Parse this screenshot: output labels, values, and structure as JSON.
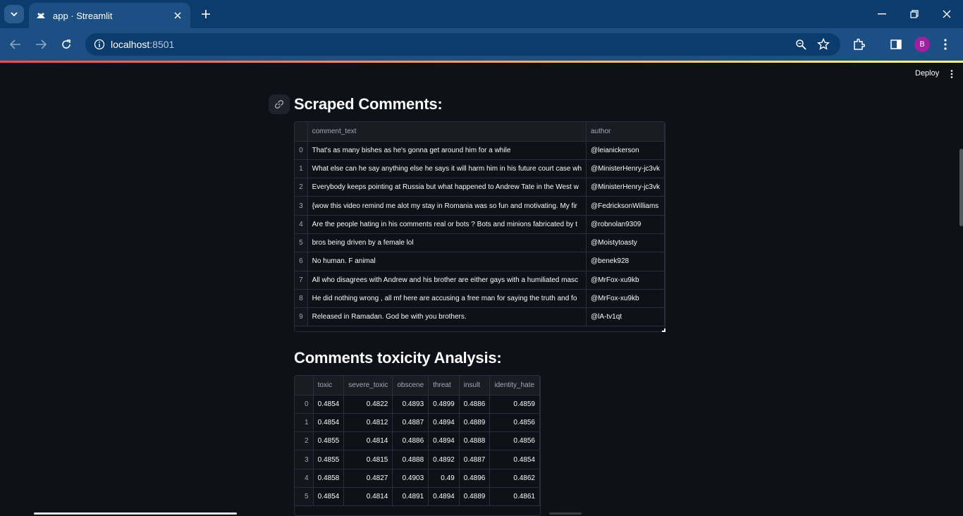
{
  "browser": {
    "tab_title": "app · Streamlit",
    "url_host": "localhost",
    "url_port": ":8501",
    "profile_initial": "B"
  },
  "header": {
    "deploy_label": "Deploy"
  },
  "section1": {
    "title": "Scraped Comments:",
    "columns": [
      "",
      "comment_text",
      "author"
    ],
    "rows": [
      {
        "idx": "0",
        "comment_text": "That's as many bishes as he's gonna get around him for a while",
        "author": "@leianickerson"
      },
      {
        "idx": "1",
        "comment_text": "What else can he say anything else he says it will harm him in his future court case wh",
        "author": "@MinisterHenry-jc3vk"
      },
      {
        "idx": "2",
        "comment_text": "Everybody keeps pointing at Russia but what happened to Andrew Tate in the West w",
        "author": "@MinisterHenry-jc3vk"
      },
      {
        "idx": "3",
        "comment_text": "{wow this video remind me alot my stay in Romania was so fun and motivating. My fir",
        "author": "@FedricksonWilliams"
      },
      {
        "idx": "4",
        "comment_text": "Are the people hating in his comments real or bots ? Bots and minions fabricated by t",
        "author": "@robnolan9309"
      },
      {
        "idx": "5",
        "comment_text": "bros being driven by a female lol",
        "author": "@Moistytoasty"
      },
      {
        "idx": "6",
        "comment_text": "No human. F animal",
        "author": "@benek928"
      },
      {
        "idx": "7",
        "comment_text": "All who disagrees with Andrew and his brother are either gays with a humiliated masc",
        "author": "@MrFox-xu9kb"
      },
      {
        "idx": "8",
        "comment_text": "He did nothing wrong , all mf here are accusing a free man for saying the truth and fo",
        "author": "@MrFox-xu9kb"
      },
      {
        "idx": "9",
        "comment_text": "Released in Ramadan. God be with you brothers.",
        "author": "@lA-tv1qt"
      }
    ]
  },
  "section2": {
    "title": "Comments toxicity Analysis:",
    "columns": [
      "",
      "toxic",
      "severe_toxic",
      "obscene",
      "threat",
      "insult",
      "identity_hate"
    ],
    "rows": [
      {
        "idx": "0",
        "toxic": "0.4854",
        "severe_toxic": "0.4822",
        "obscene": "0.4893",
        "threat": "0.4899",
        "insult": "0.4886",
        "identity_hate": "0.4859"
      },
      {
        "idx": "1",
        "toxic": "0.4854",
        "severe_toxic": "0.4812",
        "obscene": "0.4887",
        "threat": "0.4894",
        "insult": "0.4889",
        "identity_hate": "0.4856"
      },
      {
        "idx": "2",
        "toxic": "0.4855",
        "severe_toxic": "0.4814",
        "obscene": "0.4886",
        "threat": "0.4894",
        "insult": "0.4888",
        "identity_hate": "0.4856"
      },
      {
        "idx": "3",
        "toxic": "0.4855",
        "severe_toxic": "0.4815",
        "obscene": "0.4888",
        "threat": "0.4892",
        "insult": "0.4887",
        "identity_hate": "0.4854"
      },
      {
        "idx": "4",
        "toxic": "0.4858",
        "severe_toxic": "0.4827",
        "obscene": "0.4903",
        "threat": "0.49",
        "insult": "0.4896",
        "identity_hate": "0.4862"
      },
      {
        "idx": "5",
        "toxic": "0.4854",
        "severe_toxic": "0.4814",
        "obscene": "0.4891",
        "threat": "0.4894",
        "insult": "0.4889",
        "identity_hate": "0.4861"
      }
    ]
  }
}
